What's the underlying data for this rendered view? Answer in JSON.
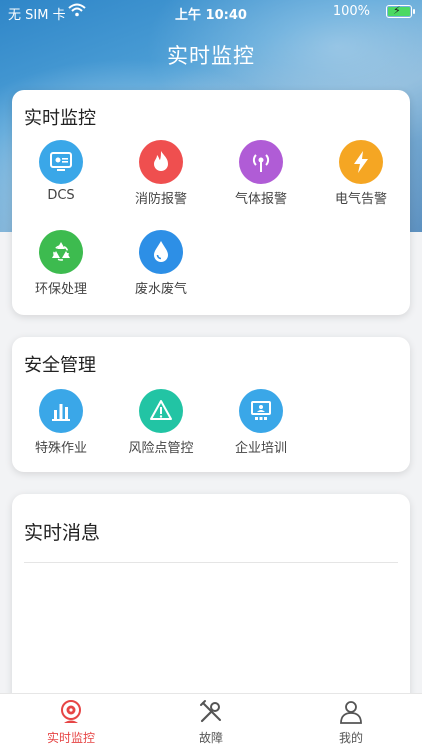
{
  "status_bar": {
    "carrier": "无 SIM 卡",
    "time": "上午 10:40",
    "battery": "100%"
  },
  "header": {
    "title": "实时监控"
  },
  "sections": [
    {
      "title": "实时监控",
      "items": [
        {
          "label": "DCS",
          "icon": "monitor-icon",
          "color": "#3aa7e8"
        },
        {
          "label": "消防报警",
          "icon": "fire-icon",
          "color": "#ef4f4f"
        },
        {
          "label": "气体报警",
          "icon": "gas-sensor-icon",
          "color": "#b05cd6"
        },
        {
          "label": "电气告警",
          "icon": "lightning-icon",
          "color": "#f5a623"
        },
        {
          "label": "环保处理",
          "icon": "recycle-icon",
          "color": "#3dbb4f"
        },
        {
          "label": "废水废气",
          "icon": "water-drop-icon",
          "color": "#2d8fe6"
        }
      ]
    },
    {
      "title": "安全管理",
      "items": [
        {
          "label": "特殊作业",
          "icon": "bar-chart-icon",
          "color": "#3aa7e8"
        },
        {
          "label": "风险点管控",
          "icon": "warning-icon",
          "color": "#22c4a4"
        },
        {
          "label": "企业培训",
          "icon": "training-icon",
          "color": "#3aa7e8"
        }
      ]
    },
    {
      "title": "实时消息"
    }
  ],
  "tabbar": {
    "tabs": [
      {
        "label": "实时监控",
        "icon": "camera-icon",
        "active": true,
        "color": "#e64545"
      },
      {
        "label": "故障",
        "icon": "tools-icon",
        "active": false
      },
      {
        "label": "我的",
        "icon": "user-icon",
        "active": false
      }
    ]
  }
}
